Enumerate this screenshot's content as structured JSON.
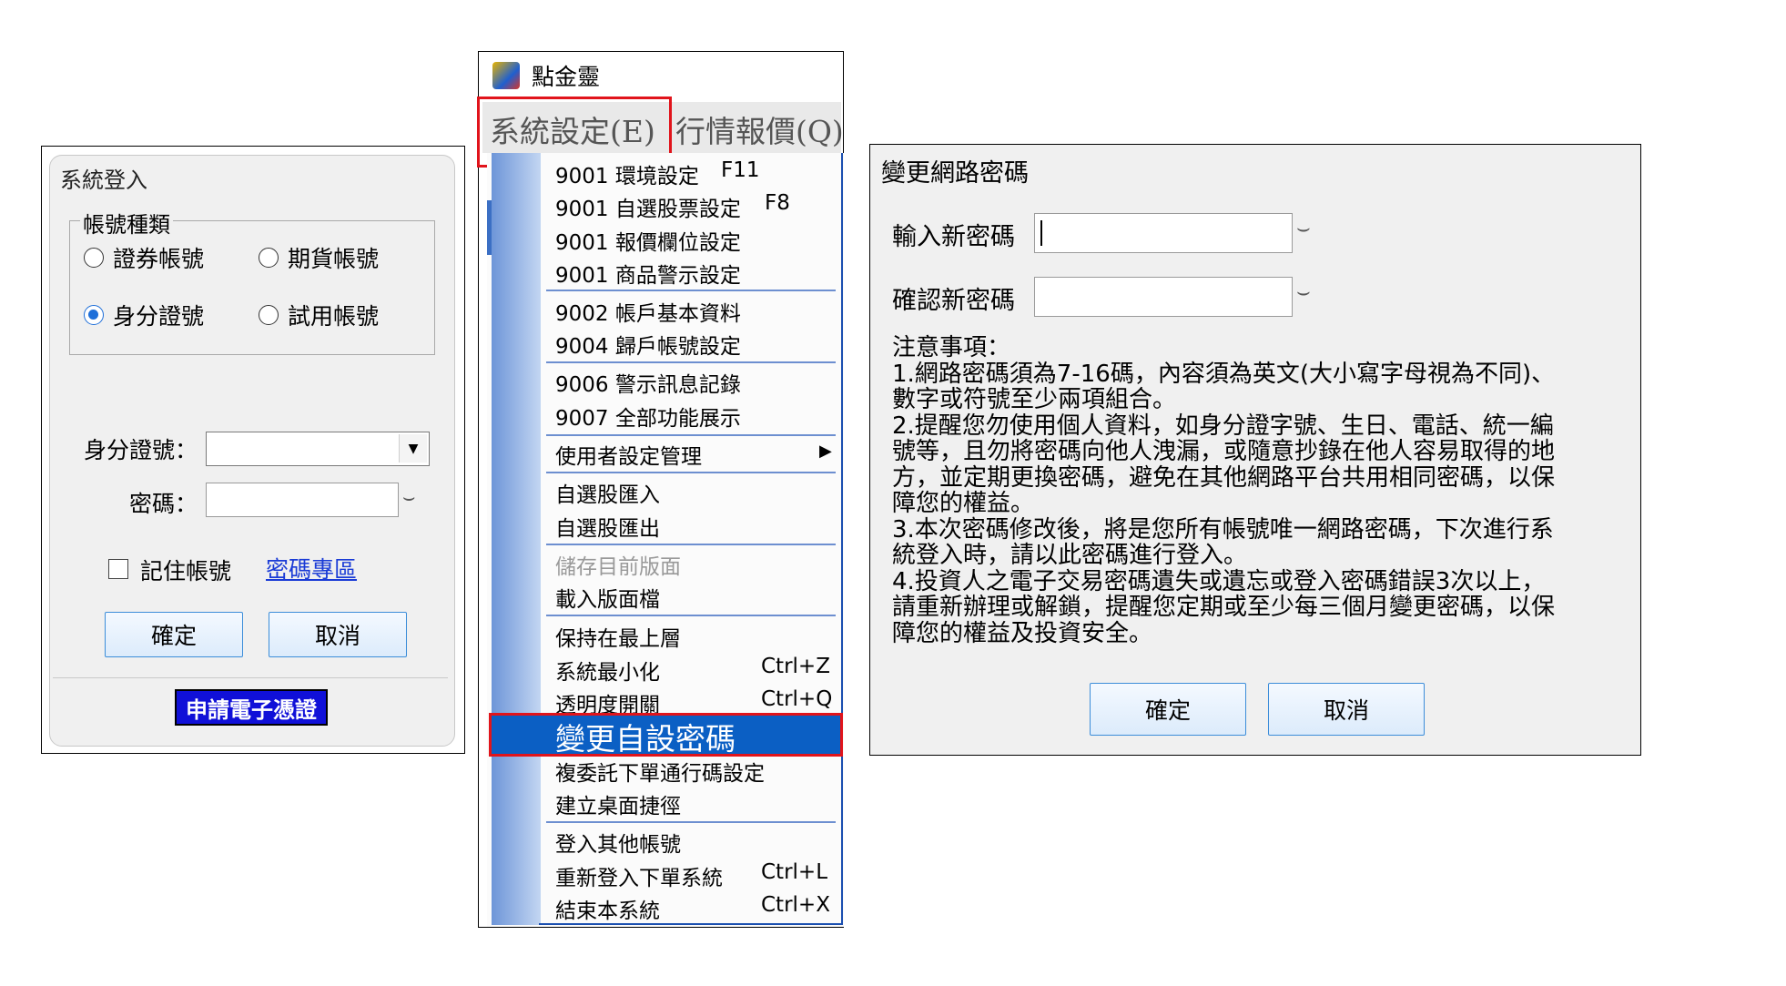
{
  "login": {
    "title": "系統登入",
    "account_type_legend": "帳號種類",
    "account_types": [
      {
        "label": "證券帳號",
        "checked": false
      },
      {
        "label": "期貨帳號",
        "checked": false
      },
      {
        "label": "身分證號",
        "checked": true
      },
      {
        "label": "試用帳號",
        "checked": false
      }
    ],
    "id_label": "身分證號：",
    "id_value": "",
    "password_label": "密碼：",
    "remember_label": "記住帳號",
    "remember_checked": false,
    "password_zone_link": "密碼專區",
    "ok_label": "確定",
    "cancel_label": "取消",
    "apply_cert_label": "申請電子憑證"
  },
  "app": {
    "title": "點金靈",
    "menubar": [
      "系統設定(E)",
      "行情報價(Q)"
    ],
    "dropdown": {
      "groups": [
        [
          {
            "label": "9001 環境設定",
            "shortcut": "F11"
          },
          {
            "label": "9001 自選股票設定",
            "shortcut": "F8"
          },
          {
            "label": "9001 報價欄位設定",
            "shortcut": ""
          },
          {
            "label": "9001 商品警示設定",
            "shortcut": ""
          }
        ],
        [
          {
            "label": "9002 帳戶基本資料",
            "shortcut": ""
          },
          {
            "label": "9004 歸戶帳號設定",
            "shortcut": ""
          }
        ],
        [
          {
            "label": "9006 警示訊息記錄",
            "shortcut": ""
          },
          {
            "label": "9007 全部功能展示",
            "shortcut": ""
          }
        ],
        [
          {
            "label": "使用者設定管理",
            "shortcut": "",
            "submenu": true
          }
        ],
        [
          {
            "label": "自選股匯入",
            "shortcut": ""
          },
          {
            "label": "自選股匯出",
            "shortcut": ""
          }
        ],
        [
          {
            "label": "儲存目前版面",
            "shortcut": "",
            "disabled": true
          },
          {
            "label": "載入版面檔",
            "shortcut": ""
          }
        ],
        [
          {
            "label": "保持在最上層",
            "shortcut": ""
          },
          {
            "label": "系統最小化",
            "shortcut": "Ctrl+Z"
          },
          {
            "label": "透明度開關",
            "shortcut": "Ctrl+Q"
          },
          {
            "label": "變更自設密碼",
            "shortcut": "",
            "selected": true
          },
          {
            "label": "複委託下單通行碼設定",
            "shortcut": ""
          },
          {
            "label": "建立桌面捷徑",
            "shortcut": ""
          }
        ],
        [
          {
            "label": "登入其他帳號",
            "shortcut": ""
          },
          {
            "label": "重新登入下單系統",
            "shortcut": "Ctrl+L"
          },
          {
            "label": "結束本系統",
            "shortcut": "Ctrl+X"
          }
        ]
      ]
    }
  },
  "change_password": {
    "title": "變更網路密碼",
    "new_pw_label": "輸入新密碼",
    "confirm_pw_label": "確認新密碼",
    "notes": [
      "注意事項：",
      "1.網路密碼須為7-16碼，內容須為英文(大小寫字母視為不同)、",
      "數字或符號至少兩項組合。",
      "2.提醒您勿使用個人資料，如身分證字號、生日、電話、統一編",
      "號等，且勿將密碼向他人洩漏，或隨意抄錄在他人容易取得的地",
      "方，並定期更換密碼，避免在其他網路平台共用相同密碼，以保",
      "障您的權益。",
      "3.本次密碼修改後，將是您所有帳號唯一網路密碼，下次進行系",
      "統登入時，請以此密碼進行登入。",
      "4.投資人之電子交易密碼遺失或遺忘或登入密碼錯誤3次以上，",
      "請重新辦理或解鎖，提醒您定期或至少每三個月變更密碼，以保",
      "障您的權益及投資安全。"
    ],
    "ok_label": "確定",
    "cancel_label": "取消"
  },
  "colors": {
    "highlight_red": "#e1141b",
    "selection_blue": "#0b5fc4",
    "link_blue": "#1a3bd6",
    "cert_button_blue": "#1010d8"
  },
  "icons": [
    "app-logo-icon",
    "eye-closed-icon",
    "dropdown-arrow-icon",
    "submenu-arrow-icon"
  ]
}
